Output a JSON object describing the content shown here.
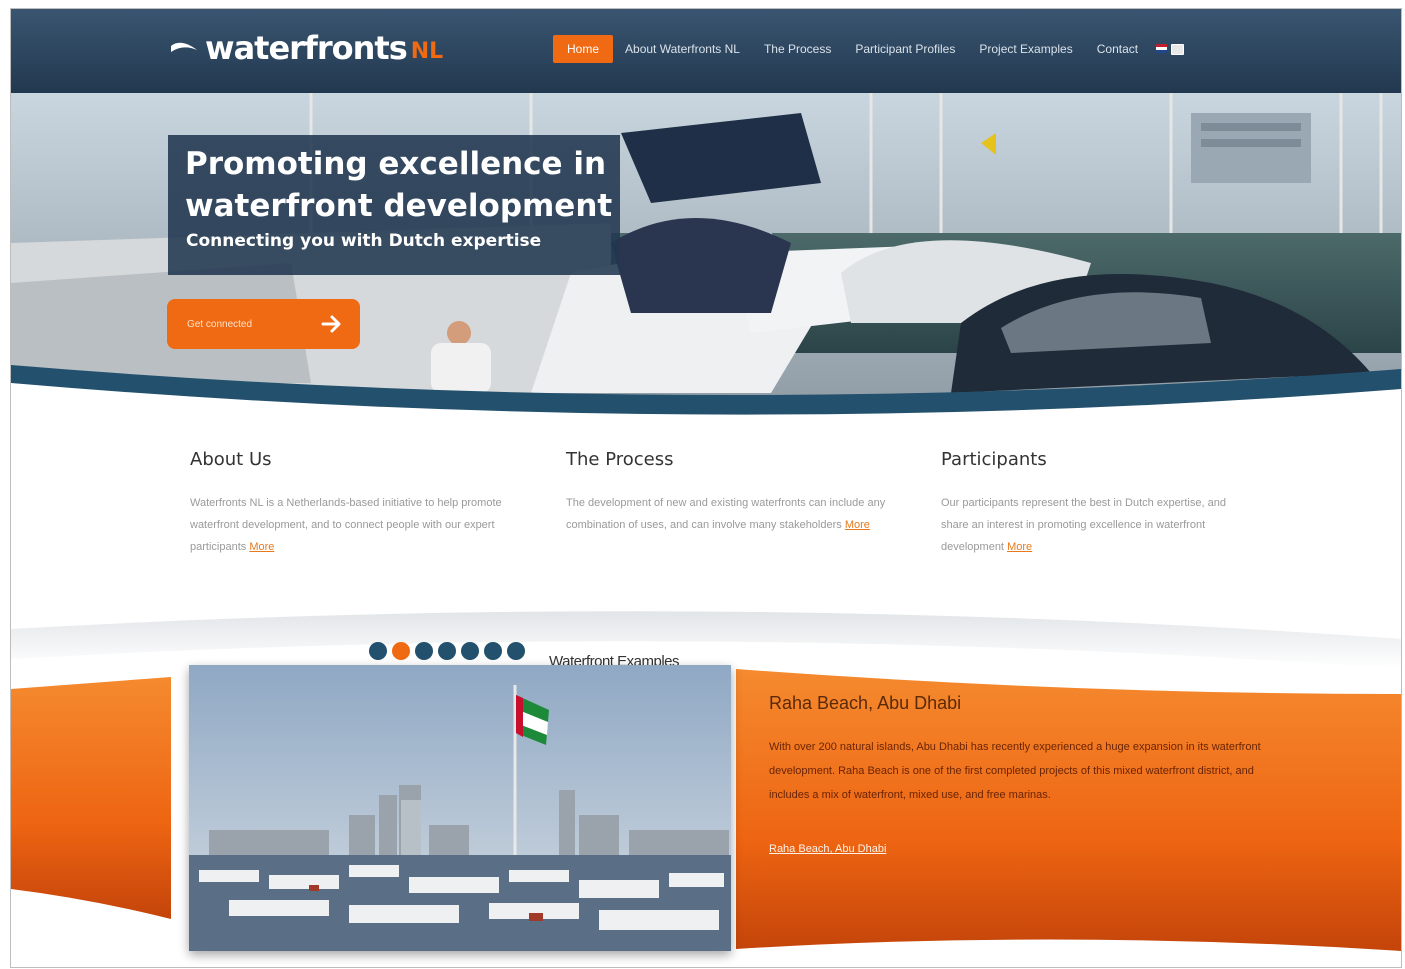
{
  "header": {
    "logo": {
      "text": "waterfronts",
      "suffix": "NL"
    },
    "nav": [
      {
        "label": "Home",
        "active": true
      },
      {
        "label": "About Waterfronts NL",
        "active": false
      },
      {
        "label": "The Process",
        "active": false
      },
      {
        "label": "Participant Profiles",
        "active": false
      },
      {
        "label": "Project Examples",
        "active": false
      },
      {
        "label": "Contact",
        "active": false
      }
    ],
    "flags": [
      "nl-flag-icon",
      "uk-flag-icon"
    ]
  },
  "hero": {
    "title": "Promoting excellence in waterfront development",
    "subtitle": "Connecting you with Dutch expertise",
    "cta_label": "Get connected",
    "cta_icon": "arrow-right-icon"
  },
  "columns": [
    {
      "heading": "About Us",
      "text": "Waterfronts NL is a Netherlands-based initiative to help promote waterfront development, and to connect people with our expert participants",
      "more": "More"
    },
    {
      "heading": "The Process",
      "text": "The development of new and existing waterfronts can include any combination of uses, and can involve many stakeholders",
      "more": "More"
    },
    {
      "heading": "Participants",
      "text": "Our participants represent the best in Dutch expertise, and share an interest in promoting excellence in waterfront development",
      "more": "More"
    }
  ],
  "examples": {
    "title": "Waterfront Examples",
    "slide_count": 7,
    "active_slide": 2,
    "heading": "Raha Beach, Abu Dhabi",
    "text": "With over 200 natural islands, Abu Dhabi has recently experienced a huge expansion in its waterfront development. Raha Beach is one of the first completed projects of this mixed waterfront district, and includes a mix of waterfront, mixed use, and free marinas.",
    "link": "Raha Beach, Abu Dhabi"
  },
  "colors": {
    "navy": "#22384f",
    "orange": "#f06a13",
    "link_orange": "#e57a1e"
  }
}
